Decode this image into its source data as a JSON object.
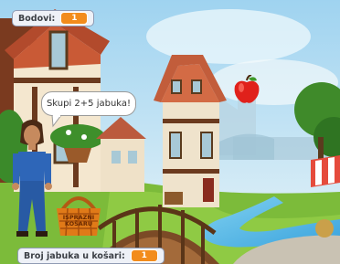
{
  "score": {
    "label": "Bodovi:",
    "value": "1"
  },
  "basket": {
    "label": "Broj jabuka u košari:",
    "value": "1",
    "empty_button_label": "ISPRAZNI KOŠARU"
  },
  "speech_bubble": {
    "text": "Skupi 2+5 jabuka!"
  },
  "sprites": {
    "apple_icon": "apple-icon",
    "girl_icon": "girl-character-icon",
    "basket_icon": "basket-icon"
  },
  "colors": {
    "monitor_value": "#f28c1c",
    "apple": "#e0211b",
    "sky": "#bfe3f5"
  }
}
